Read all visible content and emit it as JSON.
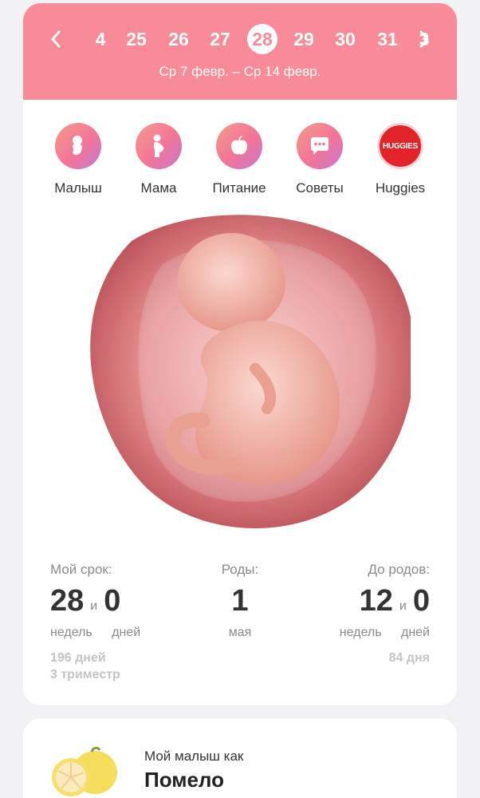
{
  "colors": {
    "header_bg": "#f98b98",
    "accent": "#f27597",
    "huggies_red": "#e2232a"
  },
  "week_nav": {
    "prev_icon": "chevron-left-icon",
    "next_icon": "chevron-right-icon",
    "weeks": [
      "4",
      "25",
      "26",
      "27",
      "28",
      "29",
      "30",
      "31",
      "3"
    ],
    "selected_week": "28",
    "date_range": "Ср 7 февр. – Ср 14 февр."
  },
  "categories": [
    {
      "label": "Малыш",
      "icon": "baby-icon"
    },
    {
      "label": "Мама",
      "icon": "pregnant-woman-icon"
    },
    {
      "label": "Питание",
      "icon": "apple-icon"
    },
    {
      "label": "Советы",
      "icon": "chat-bubble-icon"
    },
    {
      "label": "Huggies",
      "icon": "huggies-logo",
      "logo_text": "HUGGIES"
    }
  ],
  "stats": {
    "term": {
      "label": "Мой срок:",
      "weeks": "28",
      "and": "и",
      "days": "0",
      "weeks_unit": "недель",
      "days_unit": "дней",
      "total_days": "196 дней",
      "trimester": "3 триместр"
    },
    "birth": {
      "label": "Роды:",
      "day": "1",
      "month": "мая"
    },
    "until": {
      "label": "До родов:",
      "weeks": "12",
      "and": "и",
      "days": "0",
      "weeks_unit": "недель",
      "days_unit": "дней",
      "total_days": "84 дня"
    }
  },
  "fruit": {
    "pre": "Мой малыш как",
    "name": "Помело",
    "icon": "pomelo-icon"
  }
}
